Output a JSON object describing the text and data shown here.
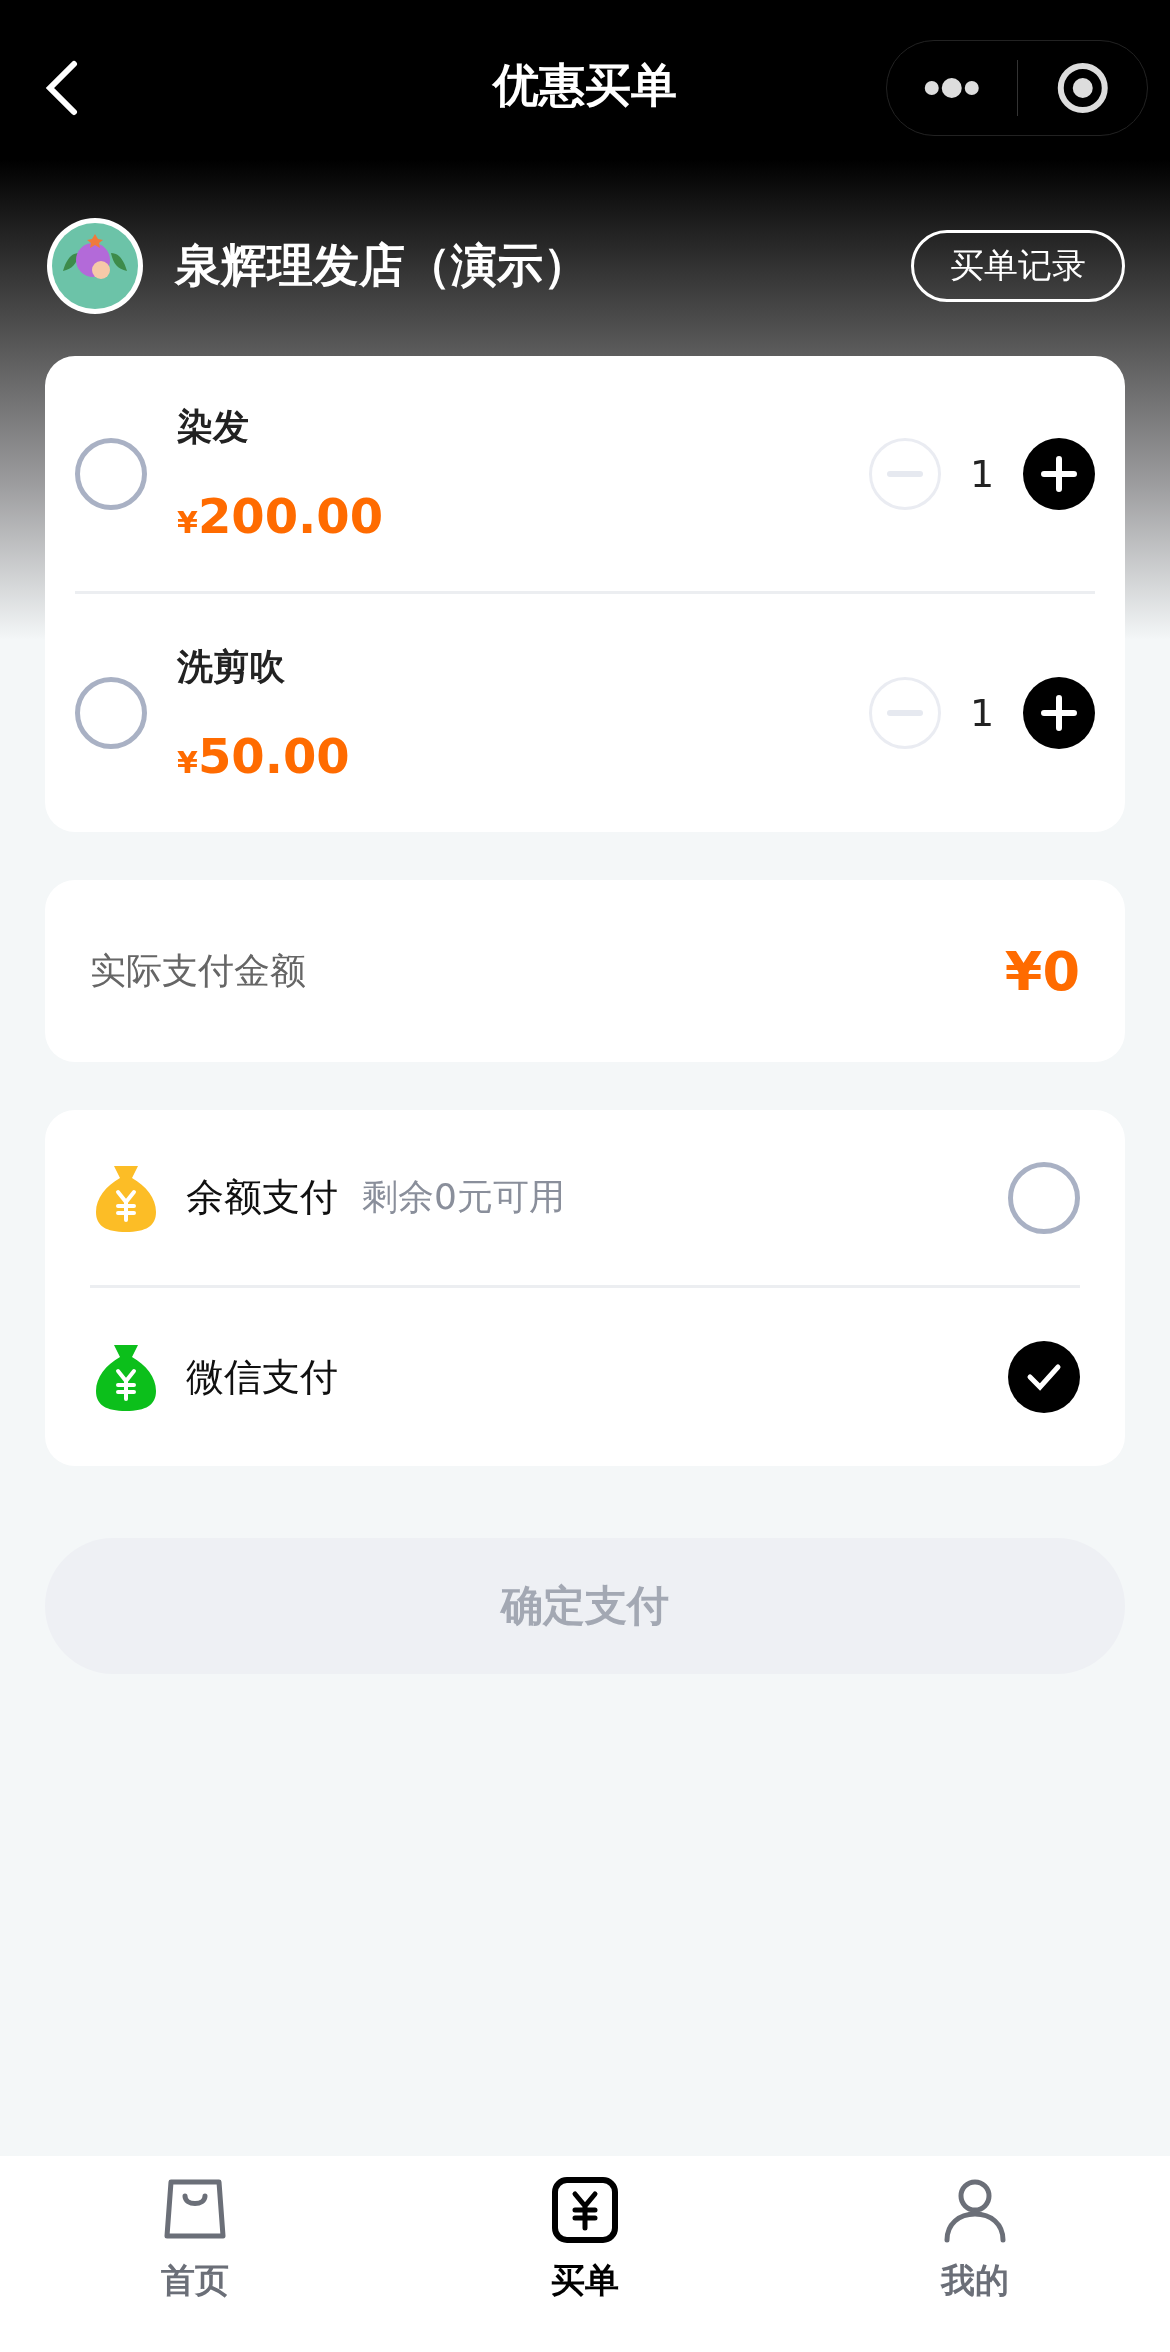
{
  "nav": {
    "title": "优惠买单"
  },
  "store": {
    "name": "泉辉理发店（演示）",
    "records_button": "买单记录"
  },
  "items": [
    {
      "name": "染发",
      "currency": "¥",
      "price": "200.00",
      "quantity": "1",
      "selected": false
    },
    {
      "name": "洗剪吹",
      "currency": "¥",
      "price": "50.00",
      "quantity": "1",
      "selected": false
    }
  ],
  "total": {
    "label": "实际支付金额",
    "amount": "¥0"
  },
  "payment_methods": [
    {
      "name": "余额支付",
      "note": "剩余0元可用",
      "color": "#fcbd26",
      "selected": false
    },
    {
      "name": "微信支付",
      "color": "#0cbf1b",
      "selected": true
    }
  ],
  "confirm_button": {
    "label": "确定支付",
    "disabled": true
  },
  "tabs": [
    {
      "label": "首页",
      "kind": "bag",
      "selected": false
    },
    {
      "label": "买单",
      "kind": "yuan",
      "selected": true
    },
    {
      "label": "我的",
      "kind": "person",
      "selected": false
    }
  ]
}
